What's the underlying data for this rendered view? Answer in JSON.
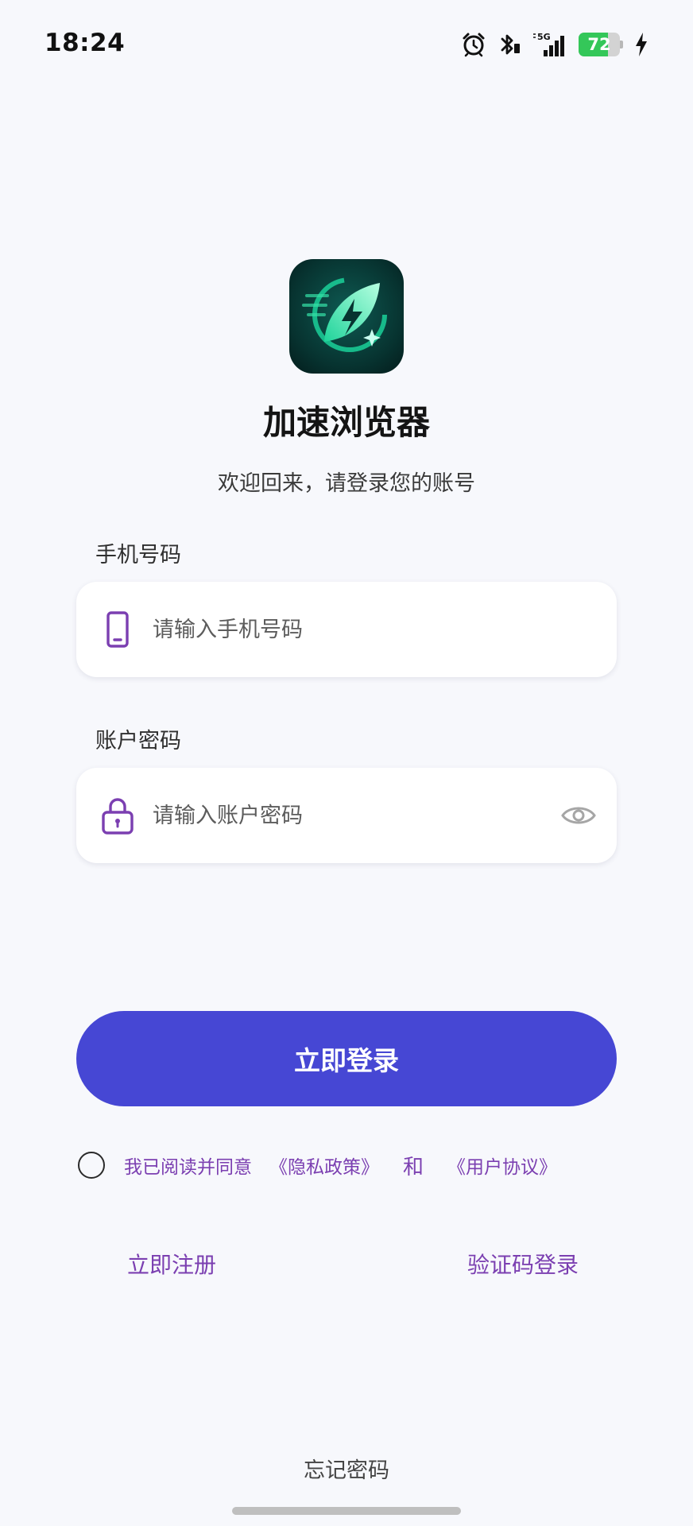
{
  "status_bar": {
    "time": "18:24",
    "network": "5G",
    "battery_level": "72",
    "battery_fraction": 0.72,
    "icons": [
      "alarm-icon",
      "bluetooth-icon",
      "signal-icon",
      "battery-icon",
      "charging-icon"
    ]
  },
  "app": {
    "title": "加速浏览器",
    "subtitle": "欢迎回来，请登录您的账号",
    "logo_icon": "leaf-lightning-logo"
  },
  "form": {
    "phone": {
      "label": "手机号码",
      "placeholder": "请输入手机号码",
      "value": "",
      "icon": "phone-icon"
    },
    "password": {
      "label": "账户密码",
      "placeholder": "请输入账户密码",
      "value": "",
      "icon": "lock-icon",
      "toggle_icon": "eye-icon"
    }
  },
  "actions": {
    "login_label": "立即登录",
    "agree_text": "我已阅读并同意",
    "privacy_link": "《隐私政策》",
    "and_text": "和",
    "terms_link": "《用户协议》",
    "register_label": "立即注册",
    "sms_login_label": "验证码登录",
    "forgot_label": "忘记密码"
  },
  "colors": {
    "primary": "#4647d4",
    "accent_purple": "#7b3fb1",
    "background": "#f7f8fc",
    "battery_green": "#34c759"
  }
}
